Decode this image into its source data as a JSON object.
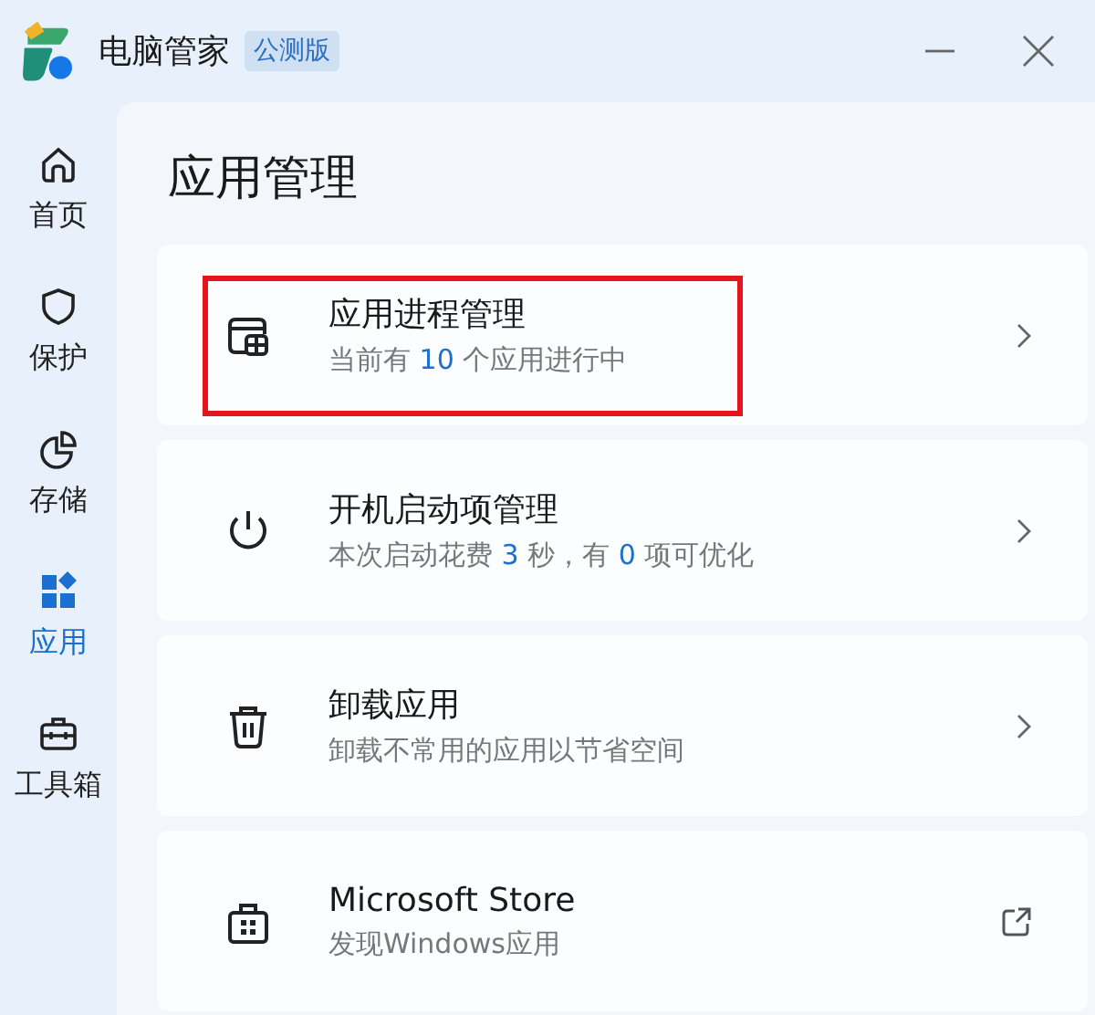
{
  "window": {
    "title": "电脑管家",
    "badge": "公测版"
  },
  "sidebar": {
    "items": [
      {
        "label": "首页",
        "selected": false
      },
      {
        "label": "保护",
        "selected": false
      },
      {
        "label": "存储",
        "selected": false
      },
      {
        "label": "应用",
        "selected": true
      },
      {
        "label": "工具箱",
        "selected": false
      }
    ]
  },
  "page": {
    "heading": "应用管理",
    "cards": [
      {
        "kind": "page",
        "title": "应用进程管理",
        "highlighted": true,
        "subtitle": [
          {
            "text": "当前有 ",
            "accent": false
          },
          {
            "text": "10",
            "accent": true
          },
          {
            "text": " 个应用进行中",
            "accent": false
          }
        ]
      },
      {
        "kind": "page",
        "title": "开机启动项管理",
        "highlighted": false,
        "subtitle": [
          {
            "text": "本次启动花费 ",
            "accent": false
          },
          {
            "text": "3",
            "accent": true
          },
          {
            "text": " 秒，有 ",
            "accent": false
          },
          {
            "text": "0",
            "accent": true
          },
          {
            "text": " 项可优化",
            "accent": false
          }
        ]
      },
      {
        "kind": "page",
        "title": "卸载应用",
        "highlighted": false,
        "subtitle": [
          {
            "text": "卸载不常用的应用以节省空间",
            "accent": false
          }
        ]
      },
      {
        "kind": "link",
        "title": "Microsoft Store",
        "highlighted": false,
        "subtitle": [
          {
            "text": "发现Windows应用",
            "accent": false
          }
        ]
      }
    ]
  }
}
